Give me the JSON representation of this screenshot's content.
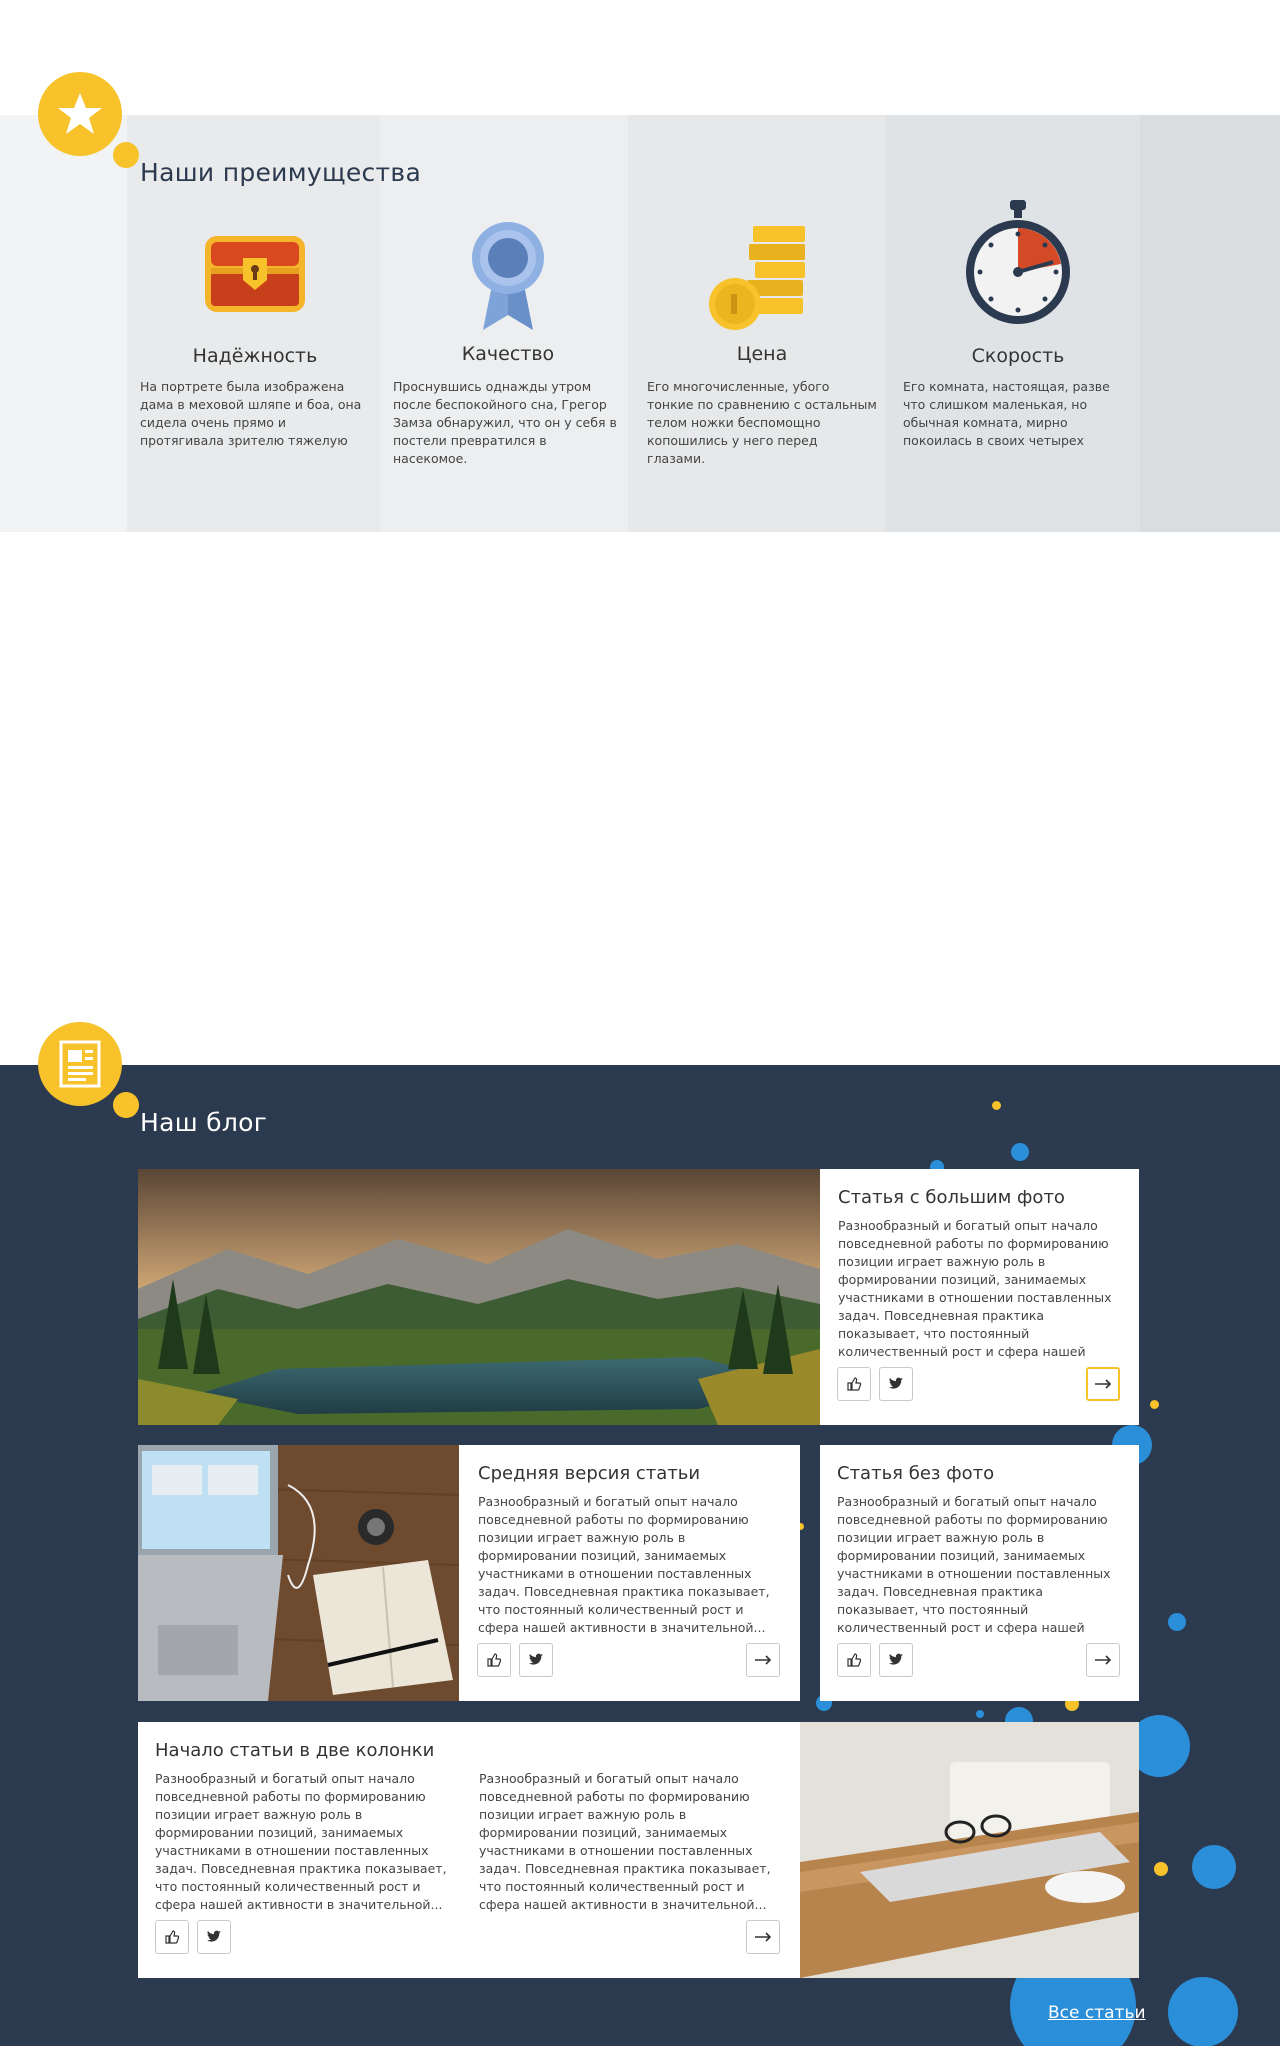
{
  "advantages": {
    "title": "Наши преимущества",
    "badge_icon": "star-icon",
    "items": [
      {
        "icon": "treasure-chest-icon",
        "title": "Надёжность",
        "text": "На портрете была изображена дама в меховой шляпе и боа, она сидела очень прямо и протягивала зрителю тяжелую"
      },
      {
        "icon": "award-ribbon-icon",
        "title": "Качество",
        "text": "Проснувшись однажды утром после беспокойного сна, Грегор Замза обнаружил, что он у себя в постели превратился в насекомое."
      },
      {
        "icon": "coins-icon",
        "title": "Цена",
        "text": "Его многочисленные, убого тонкие по сравнению с остальным телом ножки беспомощно копошились у него перед глазами."
      },
      {
        "icon": "stopwatch-icon",
        "title": "Скорость",
        "text": "Его комната, настоящая, разве что слишком маленькая, но обычная комната, мирно покоилась в своих четырех"
      }
    ]
  },
  "blog": {
    "title": "Наш блог",
    "badge_icon": "newspaper-icon",
    "cards": [
      {
        "title": "Статья с большим фото",
        "text": "Разнообразный и богатый опыт начало повседневной работы по формированию позиции играет важную роль в формировании позиций, занимаемых участниками в отношении поставленных задач. Повседневная практика показывает, что постоянный количественный рост и сфера нашей активности в значительной..."
      },
      {
        "title": "Средняя версия статьи",
        "text": "Разнообразный и богатый опыт начало повседневной работы по формированию позиции играет важную роль в формировании позиций, занимаемых участниками в отношении поставленных задач. Повседневная практика показывает, что постоянный количественный рост и сфера нашей активности в значительной..."
      },
      {
        "title": "Статья без фото",
        "text": "Разнообразный и богатый опыт начало повседневной работы по формированию позиции играет важную роль в формировании позиций, занимаемых участниками в отношении поставленных задач. Повседневная практика показывает, что постоянный количественный рост и сфера нашей"
      },
      {
        "title": "Начало статьи в две колонки",
        "text_col1": "Разнообразный и богатый опыт начало повседневной работы по формированию позиции играет важную роль в формировании позиций, занимаемых участниками в отношении поставленных задач. Повседневная практика показывает, что постоянный количественный рост и сфера нашей активности в значительной...",
        "text_col2": "Разнообразный и богатый опыт начало повседневной работы по формированию позиции играет важную роль в формировании позиций, занимаемых участниками в отношении поставленных задач. Повседневная практика показывает, что постоянный количественный рост и сфера нашей активности в значительной..."
      }
    ],
    "all_articles_label": "Все статьи"
  },
  "colors": {
    "accent": "#f7c22a",
    "blog_bg": "#2c3a4f",
    "bubble_blue": "#2a8fd8"
  }
}
